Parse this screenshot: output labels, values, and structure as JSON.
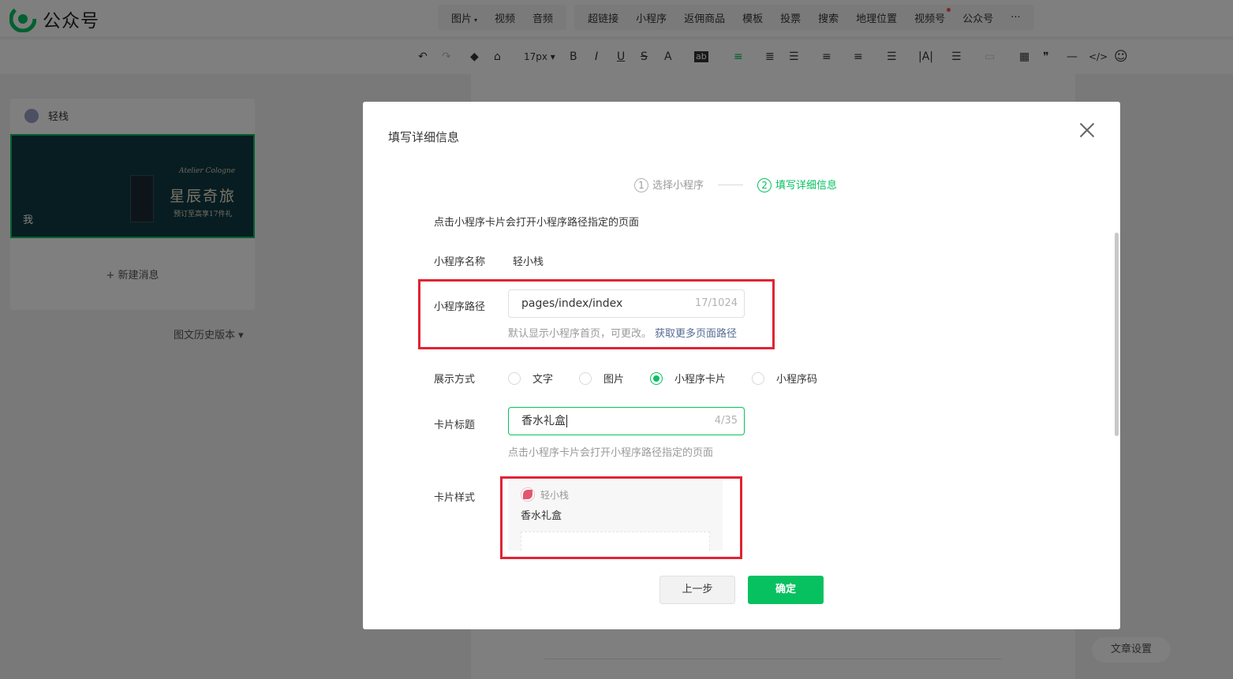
{
  "app": {
    "name": "公众号"
  },
  "insert_toolbar": {
    "group1": [
      {
        "label": "图片",
        "caret": "▾"
      },
      {
        "label": "视频"
      },
      {
        "label": "音频"
      }
    ],
    "group2": [
      {
        "label": "超链接"
      },
      {
        "label": "小程序"
      },
      {
        "label": "返佣商品"
      },
      {
        "label": "模板"
      },
      {
        "label": "投票"
      },
      {
        "label": "搜索"
      },
      {
        "label": "地理位置"
      },
      {
        "label": "视频号",
        "badge": true
      },
      {
        "label": "公众号"
      },
      {
        "label": "···"
      }
    ]
  },
  "format_toolbar": {
    "font_size": "17px ▾",
    "icons": [
      "undo-icon",
      "redo-icon",
      "format-painter-icon",
      "clear-format-icon",
      "bold-icon",
      "italic-icon",
      "underline-icon",
      "strikethrough-icon",
      "font-color-icon",
      "background-color-icon",
      "align-left-icon",
      "indent-icon",
      "first-indent-icon",
      "paragraph-spacing-icon",
      "line-height-icon",
      "letter-spacing-icon",
      "text-direction-icon",
      "list-icon",
      "table-icon",
      "quote-icon",
      "divider-icon",
      "code-icon",
      "emoji-icon"
    ],
    "glyphs": {
      "bold": "B",
      "italic": "I",
      "underline": "U",
      "strike": "S",
      "fontcolor": "A",
      "bg": "ab",
      "undo": "↶",
      "redo": "↷",
      "table": "▦",
      "quote": "❞",
      "hr": "—",
      "code": "</>",
      "emoji": "☺"
    }
  },
  "left_panel": {
    "account_name": "轻栈",
    "cover": {
      "brand": "Atelier Cologne",
      "title": "星辰奇旅",
      "subtitle": "预订至高享17件礼",
      "author_tag": "我"
    },
    "new_message": "+ 新建消息",
    "history": "图文历史版本 ▾"
  },
  "article_settings": "文章设置",
  "dialog": {
    "title": "填写详细信息",
    "steps": [
      {
        "num": "1",
        "label": "选择小程序",
        "state": "done"
      },
      {
        "num": "2",
        "label": "填写详细信息",
        "state": "active"
      }
    ],
    "hint_top": "点击小程序卡片会打开小程序路径指定的页面",
    "mp_name_label": "小程序名称",
    "mp_name_value": "轻小栈",
    "path_label": "小程序路径",
    "path_value": "pages/index/index",
    "path_count": "17/1024",
    "path_tip": "默认显示小程序首页，可更改。",
    "path_tip_link": "获取更多页面路径",
    "display_label": "展示方式",
    "display_options": [
      {
        "label": "文字",
        "checked": false
      },
      {
        "label": "图片",
        "checked": false
      },
      {
        "label": "小程序卡片",
        "checked": true
      },
      {
        "label": "小程序码",
        "checked": false
      }
    ],
    "card_title_label": "卡片标题",
    "card_title_value": "香水礼盒",
    "card_title_count": "4/35",
    "card_title_tip": "点击小程序卡片会打开小程序路径指定的页面",
    "card_style_label": "卡片样式",
    "card_preview": {
      "app_name": "轻小栈",
      "title": "香水礼盒"
    },
    "btn_prev": "上一步",
    "btn_ok": "确定"
  },
  "colors": {
    "accent": "#07c160",
    "highlight_box": "#e02433",
    "link": "#576b95"
  }
}
